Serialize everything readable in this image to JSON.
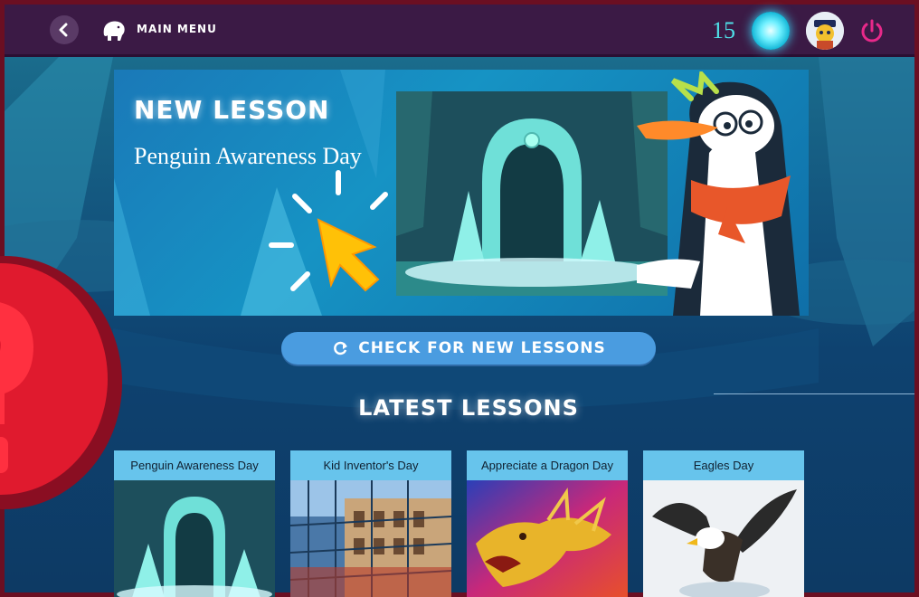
{
  "header": {
    "back_icon": "chevron-left-icon",
    "menu_label": "MAIN MENU",
    "points": "15",
    "colors": {
      "bar": "#3b1a45",
      "points": "#4fe0e8",
      "power": "#e8298a"
    }
  },
  "hero": {
    "label": "NEW LESSON",
    "title": "Penguin Awareness Day"
  },
  "check_button": {
    "label": "CHECK FOR NEW LESSONS",
    "icon": "refresh-icon"
  },
  "latest": {
    "heading": "LATEST LESSONS",
    "cards": [
      {
        "title": "Penguin Awareness Day"
      },
      {
        "title": "Kid Inventor's Day"
      },
      {
        "title": "Appreciate a Dragon Day"
      },
      {
        "title": "Eagles Day"
      }
    ]
  }
}
